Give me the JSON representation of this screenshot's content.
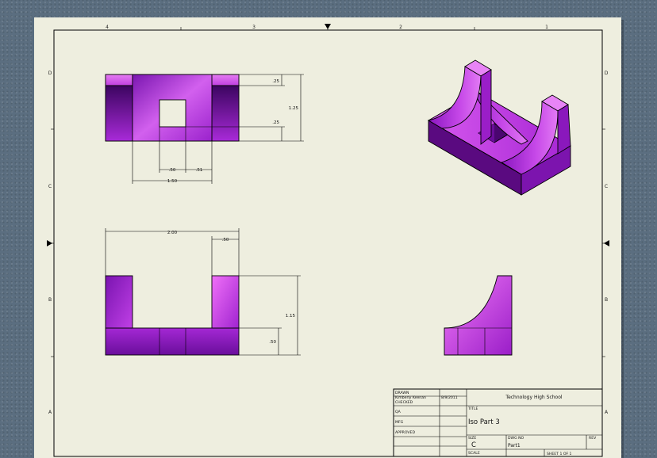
{
  "sheet": {
    "zones_top": [
      "4",
      "3",
      "2",
      "1"
    ],
    "zones_left": [
      "D",
      "C",
      "B",
      "A"
    ],
    "zones_right": [
      "D",
      "C",
      "B",
      "A"
    ]
  },
  "dimensions": {
    "front_top_ext": ".25",
    "front_height": "1.25",
    "front_hole_to_bottom": ".25",
    "front_hole_width": ".50",
    "front_hole_offset": ".51",
    "front_inner_width": "1.50",
    "bottom_overall_width": "2.00",
    "bottom_upright_width": ".50",
    "bottom_height": "1.15",
    "bottom_base_height": ".50"
  },
  "title_block": {
    "drawn_label": "DRAWN",
    "drawn_by": "Kimberly Keenan",
    "drawn_date": "8/9/2011",
    "checked_label": "CHECKED",
    "qa_label": "QA",
    "mfg_label": "MFG",
    "approved_label": "APPROVED",
    "company": "Technology High School",
    "title_label": "TITLE",
    "title": "Iso Part 3",
    "size_label": "SIZE",
    "size": "C",
    "dwg_label": "DWG NO",
    "dwg_no": "Part1",
    "rev_label": "REV",
    "scale_label": "SCALE",
    "sheet_info": "SHEET 1  OF 1"
  },
  "colors": {
    "sheet": "#eeeedf",
    "desk": "#5b6e80",
    "part_light": "#e060f0",
    "part_mid": "#a020d0",
    "part_dark": "#5a0a80"
  }
}
